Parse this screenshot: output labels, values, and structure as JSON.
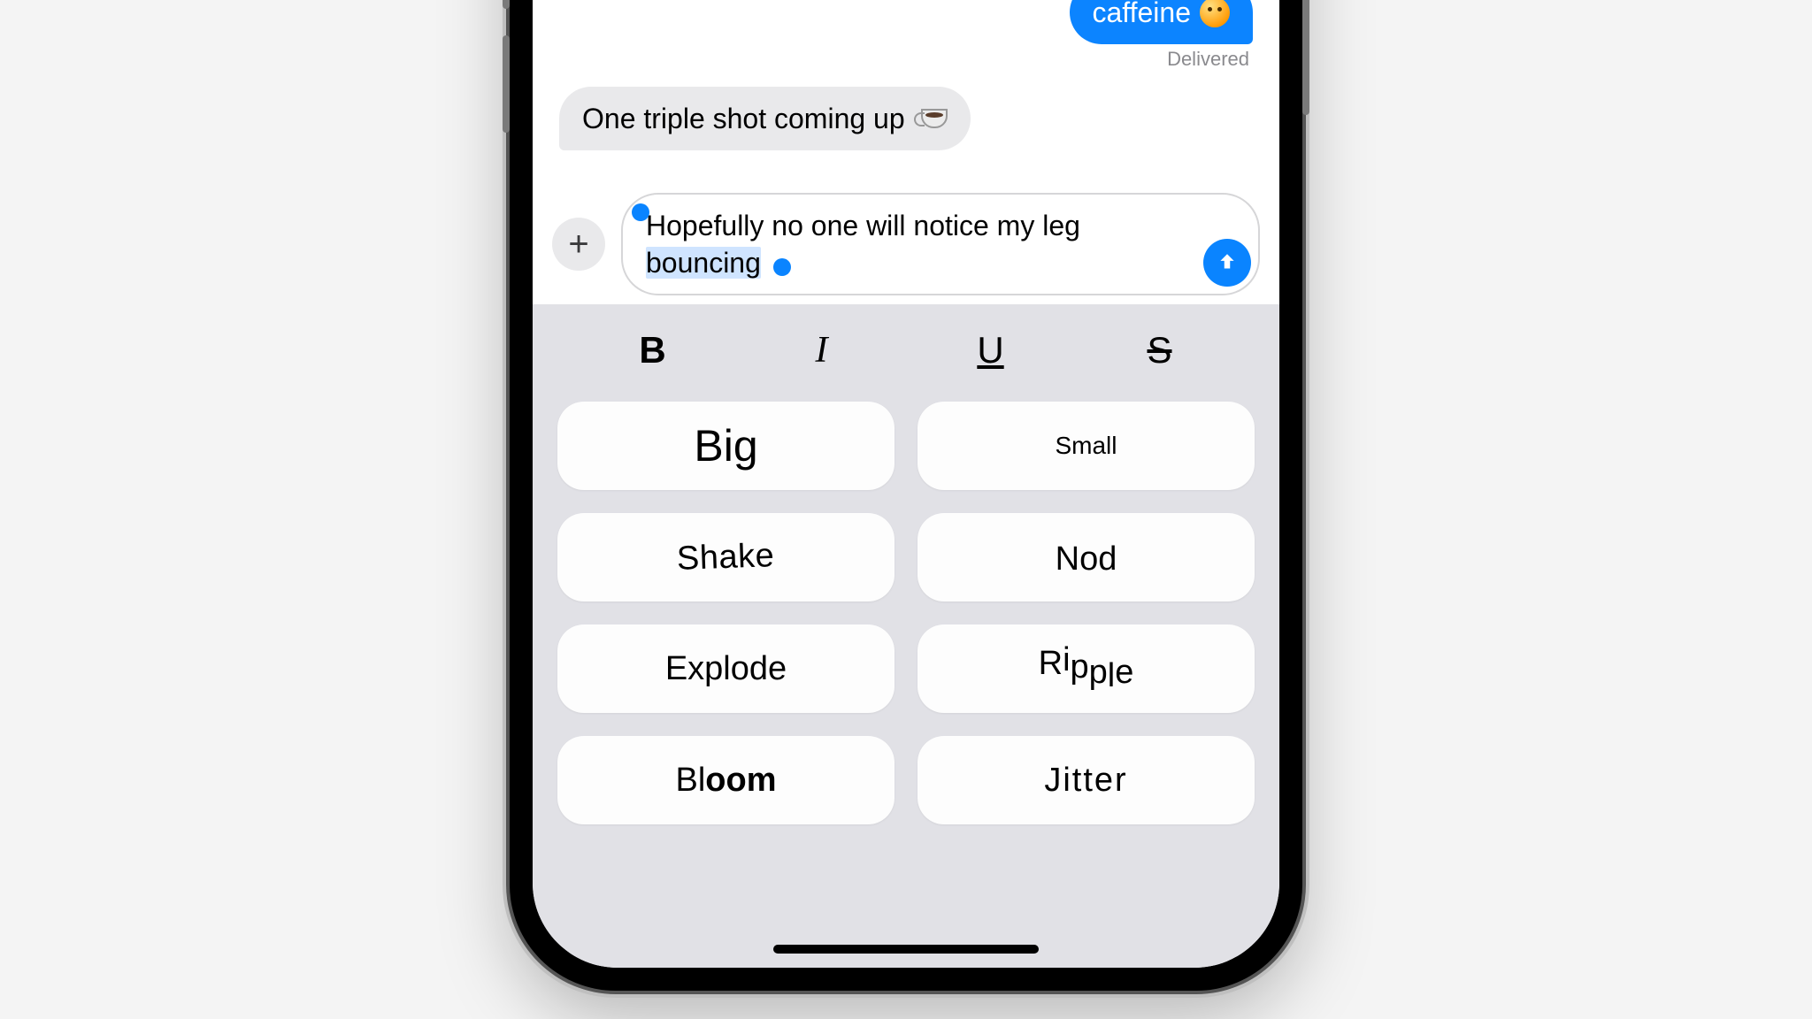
{
  "chat": {
    "sent_visible_text": "caffeine",
    "delivered_label": "Delivered",
    "received_text": "One triple shot coming up",
    "compose_pre": "Hopefully no one will notice my leg ",
    "compose_sel": "bouncing"
  },
  "format": {
    "bold": "B",
    "italic": "I",
    "under": "U",
    "strike": "S"
  },
  "effects": {
    "big": "Big",
    "small": "Small",
    "shake": "Shake",
    "nod": "Nod",
    "explode": "Explode",
    "ripple": "Ripple",
    "bloom": "Bloom",
    "jitter": "Jitter"
  }
}
